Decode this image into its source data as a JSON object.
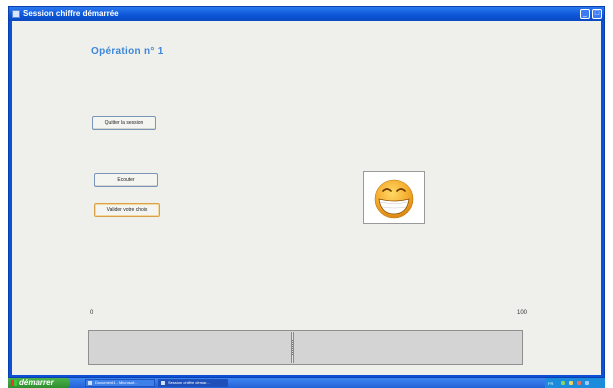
{
  "window": {
    "title": "Session chiffre démarrée",
    "minimize_glyph": "_",
    "maximize_glyph": "□"
  },
  "main": {
    "operation_title": "Opération n° 1",
    "buttons": {
      "quit_label": "Quitter la session",
      "listen_label": "Ecouter",
      "validate_label": "Valider votre choix"
    },
    "feedback_icon": "laughing-smiley-icon",
    "scale": {
      "min_label": "0",
      "max_label": "100",
      "value_fraction": 0.47
    }
  },
  "taskbar": {
    "start_label": "démarrer",
    "items": [
      {
        "label": "Document1 - Microsof...",
        "icon": "word-document-icon"
      },
      {
        "label": "Session chiffre démar...",
        "icon": "app-window-icon"
      }
    ],
    "tray_lang": "FR"
  },
  "colors": {
    "title_blue": "#0c55d6",
    "operation_title": "#3d87d6",
    "smiley_face": "#f4a92a"
  }
}
